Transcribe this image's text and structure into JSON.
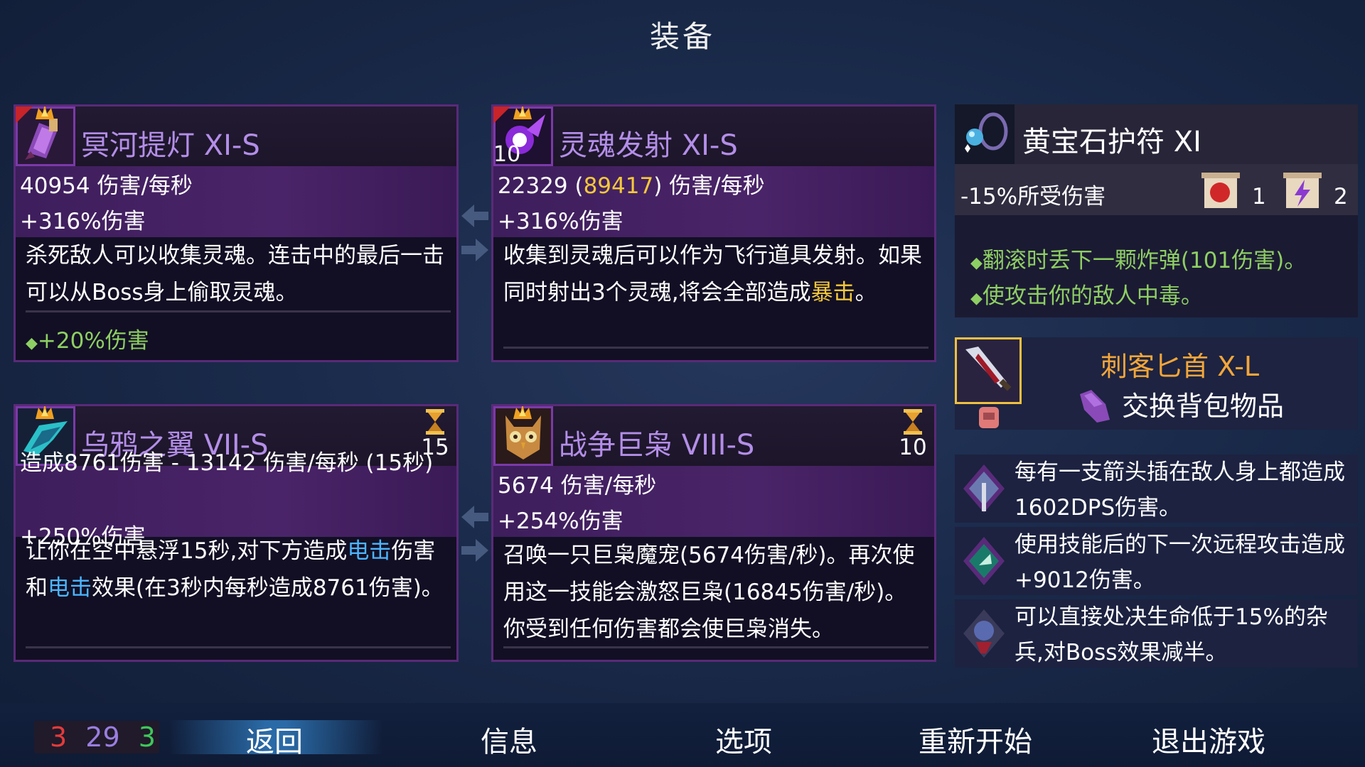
{
  "screen_title": "装备",
  "cards": {
    "lamp": {
      "name": "冥河提灯 XI-S",
      "dps": "40954 伤害/每秒",
      "bonus_dmg": "+316%伤害",
      "desc": "杀死敌人可以收集灵魂。连击中的最后一击可以从Boss身上偷取灵魂。",
      "affix": "+20%伤害"
    },
    "soul": {
      "name": "灵魂发射 XI-S",
      "badge": "10",
      "dps_prefix": "22329 (",
      "dps_highlight": "89417",
      "dps_suffix": ") 伤害/每秒",
      "bonus_dmg": "+316%伤害",
      "desc_a": "收集到灵魂后可以作为飞行道具发射。如果同时射出3个灵魂,将会全部造成",
      "desc_highlight": "暴击",
      "desc_b": "。"
    },
    "crow": {
      "name": "乌鸦之翼 VII-S",
      "cooldown": "15",
      "dmg": "造成8761伤害 - 13142 伤害/每秒 (15秒)",
      "bonus_dmg": "+250%伤害",
      "desc_a": "让你在空中悬浮15秒,对下方造成",
      "desc_hl1": "电击",
      "desc_b": "伤害和",
      "desc_hl2": "电击",
      "desc_c": "效果(在3秒内每秒造成8761伤害)。"
    },
    "owl": {
      "name": "战争巨枭 VIII-S",
      "cooldown": "10",
      "dps": "5674 伤害/每秒",
      "bonus_dmg": "+254%伤害",
      "desc": "召唤一只巨枭魔宠(5674伤害/秒)。再次使用这一技能会激怒巨枭(16845伤害/秒)。你受到任何伤害都会使巨枭消失。"
    }
  },
  "amulet": {
    "name": "黄宝石护符 XI",
    "stat": "-15%所受伤害",
    "scroll_red_count": "1",
    "scroll_purple_count": "2",
    "bonus1": "翻滚时丢下一颗炸弹(101伤害)。",
    "bonus2": "使攻击你的敌人中毒。"
  },
  "backpack": {
    "weapon_name": "刺客匕首 X-L",
    "action": "交换背包物品"
  },
  "mutations": [
    {
      "text": "每有一支箭头插在敌人身上都造成1602DPS伤害。"
    },
    {
      "text": "使用技能后的下一次远程攻击造成+9012伤害。"
    },
    {
      "text": "可以直接处决生命低于15%的杂兵,对Boss效果减半。"
    }
  ],
  "counter": {
    "red": "3",
    "purple": "29",
    "green": "3"
  },
  "nav": {
    "back": "返回",
    "info": "信息",
    "options": "选项",
    "restart": "重新开始",
    "quit": "退出游戏"
  },
  "colors": {
    "accent_purple": "#b38ee8",
    "highlight_yellow": "#f5c93a",
    "highlight_blue": "#4cb6ff",
    "bonus_green": "#8ecf63",
    "weapon_orange": "#f3a63a"
  }
}
